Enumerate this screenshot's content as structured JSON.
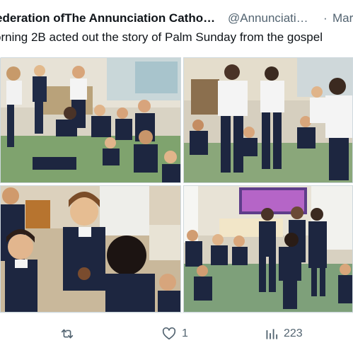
{
  "tweet": {
    "author_name": "ederation ofThe Annunciation Catho…",
    "handle": "@Annunciati…",
    "separator": "·",
    "date": "Mar",
    "text": "orning 2B acted out the story of Palm Sunday from the gospel"
  },
  "media": {
    "photos": [
      {
        "name": "classroom-photo-1"
      },
      {
        "name": "classroom-photo-2"
      },
      {
        "name": "classroom-photo-3"
      },
      {
        "name": "classroom-photo-4"
      }
    ]
  },
  "actions": {
    "retweet_icon": "retweet-icon",
    "retweet_count": "",
    "like_icon": "heart-icon",
    "like_count": "1",
    "views_icon": "views-bar-chart-icon",
    "views_count": "223"
  },
  "colors": {
    "text": "#0f1419",
    "secondary": "#536471",
    "divider": "#eff3f4"
  }
}
